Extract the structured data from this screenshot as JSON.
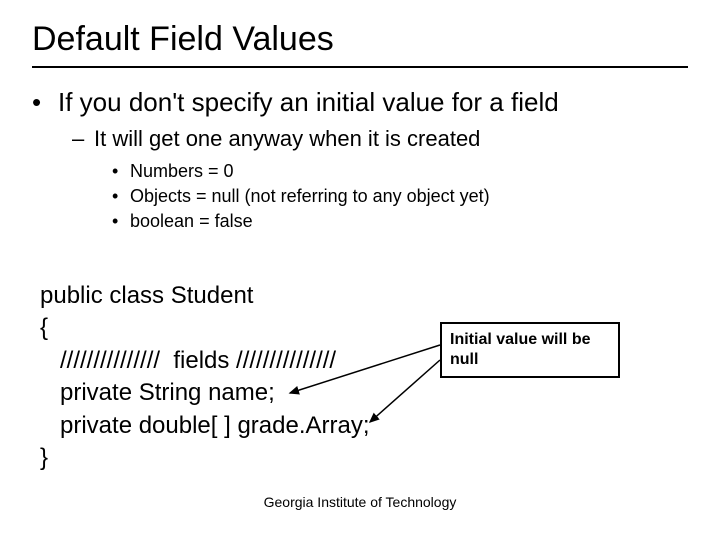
{
  "title": "Default Field Values",
  "bullets": {
    "l1": "If you don't specify an initial value for a field",
    "l2": "It will get one anyway when it is created",
    "l3a": "Numbers = 0",
    "l3b": "Objects = null (not referring to any object yet)",
    "l3c": "boolean = false"
  },
  "code": {
    "line1": "public class Student",
    "line2": "{",
    "line3": "   ///////////////  fields ///////////////",
    "line4": "   private String name;",
    "line5": "   private double[ ] grade.Array;",
    "line6": "}"
  },
  "callout": "Initial value will be null",
  "footer": "Georgia Institute of Technology"
}
